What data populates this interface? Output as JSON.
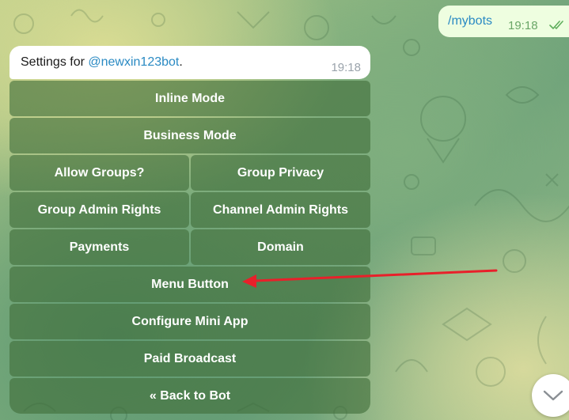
{
  "outgoing_message": {
    "text": "/mybots",
    "time": "19:18",
    "status_icon": "double-check-icon"
  },
  "bot_message": {
    "text_prefix": "Settings for ",
    "mention": "@newxin123bot",
    "text_suffix": ".",
    "time": "19:18"
  },
  "keyboard": {
    "rows": [
      [
        "Inline Mode"
      ],
      [
        "Business Mode"
      ],
      [
        "Allow Groups?",
        "Group Privacy"
      ],
      [
        "Group Admin Rights",
        "Channel Admin Rights"
      ],
      [
        "Payments",
        "Domain"
      ],
      [
        "Menu Button"
      ],
      [
        "Configure Mini App"
      ],
      [
        "Paid Broadcast"
      ],
      [
        "« Back to Bot"
      ]
    ]
  },
  "annotation": {
    "type": "arrow",
    "color": "#e8202a",
    "points_to": "Menu Button"
  },
  "scroll_button": {
    "icon": "chevron-down-icon"
  },
  "colors": {
    "link": "#2a8ac3",
    "outgoing_bubble": "#eefee0",
    "outgoing_time": "#6aa667",
    "incoming_bubble": "#ffffff",
    "keyboard_button": "#406e3a"
  }
}
